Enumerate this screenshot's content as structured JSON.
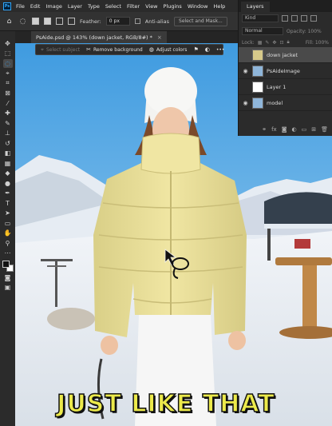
{
  "menu": {
    "logo": "Ps",
    "items": [
      "File",
      "Edit",
      "Image",
      "Layer",
      "Type",
      "Select",
      "Filter",
      "View",
      "Plugins",
      "Window",
      "Help"
    ]
  },
  "options": {
    "feather_label": "Feather:",
    "feather_value": "0 px",
    "antialias_label": "Anti-alias",
    "select_mask_label": "Select and Mask..."
  },
  "document": {
    "tab_title": "PsAide.psd @ 143% (down jacket, RGB/8#) *",
    "close_glyph": "×"
  },
  "taskbar": {
    "select_subject": "Select subject",
    "remove_background": "Remove background",
    "adjust_colors": "Adjust colors",
    "more_glyph": "•••"
  },
  "layers": {
    "tab_label": "Layers",
    "kind_label": "Kind",
    "blend_mode": "Normal",
    "opacity_label": "Opacity: 100%",
    "lock_label": "Lock:",
    "fill_label": "Fill: 100%",
    "items": [
      {
        "name": "down jacket",
        "visible": false,
        "selected": true,
        "thumb": "#d6c98a"
      },
      {
        "name": "PsAideImage",
        "visible": true,
        "selected": false,
        "thumb": "#8fb6da"
      },
      {
        "name": "Layer 1",
        "visible": false,
        "selected": false,
        "thumb": "#ffffff"
      },
      {
        "name": "model",
        "visible": true,
        "selected": false,
        "thumb": "#8fb6da"
      }
    ]
  },
  "caption": "JUST LIKE THAT",
  "colors": {
    "accent": "#31a8ff",
    "jacket": "#ece29c",
    "caption": "#ecea4b"
  }
}
